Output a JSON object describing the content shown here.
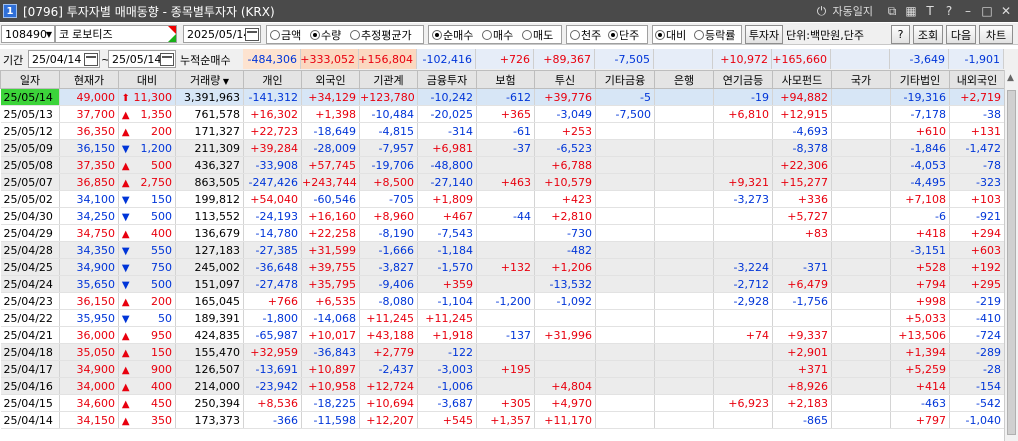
{
  "window": {
    "number": "1",
    "title": "[0796] 투자자별 매매동향 - 종목별투자자 (KRX)",
    "auto_label": "자동일지"
  },
  "toolbar1": {
    "code": "108490",
    "code_prefix": "코",
    "stock_name": "로보티즈",
    "date": "2025/05/14",
    "radio_amount": "금액",
    "radio_qty": "수량",
    "radio_avg": "추정평균가",
    "radio_net": "순매수",
    "radio_buy": "매수",
    "radio_sell": "매도",
    "radio_thousand": "천주",
    "radio_unit": "단주",
    "radio_compare": "대비",
    "radio_rate": "등락률",
    "investor_btn": "투자자",
    "unit_text": "단위:백만원,단주",
    "help": "?",
    "query": "조회",
    "next": "다음",
    "chart": "차트"
  },
  "toolbar2": {
    "period_label": "기간",
    "from": "25/04/14",
    "to": "25/05/14",
    "tilde": "~",
    "cum_label": "누적순매수",
    "sums": [
      "-484,306",
      "+333,052",
      "+156,804",
      "-102,416",
      "+726",
      "+89,367",
      "-7,505",
      "",
      "+10,972",
      "+165,660",
      "",
      "-3,649",
      "-1,901"
    ]
  },
  "columns": [
    "일자",
    "현재가",
    "대비",
    "거래량",
    "개인",
    "외국인",
    "기관계",
    "금융투자",
    "보험",
    "투신",
    "기타금융",
    "은행",
    "연기금등",
    "사모펀드",
    "국가",
    "기타법인",
    "내외국인"
  ],
  "rows": [
    [
      "25/05/14",
      "49,000",
      "up",
      "11,300",
      "3,391,963",
      "-141,312",
      "+34,129",
      "+123,780",
      "-10,242",
      "-612",
      "+39,776",
      "-5",
      "",
      "-19",
      "+94,882",
      "",
      "-19,316",
      "+2,719"
    ],
    [
      "25/05/13",
      "37,700",
      "tri-up",
      "1,350",
      "761,578",
      "+16,302",
      "+1,398",
      "-10,484",
      "-20,025",
      "+365",
      "-3,049",
      "-7,500",
      "",
      "+6,810",
      "+12,915",
      "",
      "-7,178",
      "-38"
    ],
    [
      "25/05/12",
      "36,350",
      "tri-up",
      "200",
      "171,327",
      "+22,723",
      "-18,649",
      "-4,815",
      "-314",
      "-61",
      "+253",
      "",
      "",
      "",
      "-4,693",
      "",
      "+610",
      "+131"
    ],
    [
      "25/05/09",
      "36,150",
      "tri-down",
      "1,200",
      "211,309",
      "+39,284",
      "-28,009",
      "-7,957",
      "+6,981",
      "-37",
      "-6,523",
      "",
      "",
      "",
      "-8,378",
      "",
      "-1,846",
      "-1,472"
    ],
    [
      "25/05/08",
      "37,350",
      "tri-up",
      "500",
      "436,327",
      "-33,908",
      "+57,745",
      "-19,706",
      "-48,800",
      "",
      "+6,788",
      "",
      "",
      "",
      "+22,306",
      "",
      "-4,053",
      "-78"
    ],
    [
      "25/05/07",
      "36,850",
      "tri-up",
      "2,750",
      "863,505",
      "-247,426",
      "+243,744",
      "+8,500",
      "-27,140",
      "+463",
      "+10,579",
      "",
      "",
      "+9,321",
      "+15,277",
      "",
      "-4,495",
      "-323"
    ],
    [
      "25/05/02",
      "34,100",
      "tri-down",
      "150",
      "199,812",
      "+54,040",
      "-60,546",
      "-705",
      "+1,809",
      "",
      "+423",
      "",
      "",
      "-3,273",
      "+336",
      "",
      "+7,108",
      "+103"
    ],
    [
      "25/04/30",
      "34,250",
      "tri-down",
      "500",
      "113,552",
      "-24,193",
      "+16,160",
      "+8,960",
      "+467",
      "-44",
      "+2,810",
      "",
      "",
      "",
      "+5,727",
      "",
      "-6",
      "-921"
    ],
    [
      "25/04/29",
      "34,750",
      "tri-up",
      "400",
      "136,679",
      "-14,780",
      "+22,258",
      "-8,190",
      "-7,543",
      "",
      "-730",
      "",
      "",
      "",
      "+83",
      "",
      "+418",
      "+294"
    ],
    [
      "25/04/28",
      "34,350",
      "tri-down",
      "550",
      "127,183",
      "-27,385",
      "+31,599",
      "-1,666",
      "-1,184",
      "",
      "-482",
      "",
      "",
      "",
      "",
      "",
      "-3,151",
      "+603"
    ],
    [
      "25/04/25",
      "34,900",
      "tri-down",
      "750",
      "245,002",
      "-36,648",
      "+39,755",
      "-3,827",
      "-1,570",
      "+132",
      "+1,206",
      "",
      "",
      "-3,224",
      "-371",
      "",
      "+528",
      "+192"
    ],
    [
      "25/04/24",
      "35,650",
      "tri-down",
      "500",
      "151,097",
      "-27,478",
      "+35,795",
      "-9,406",
      "+359",
      "",
      "-13,532",
      "",
      "",
      "-2,712",
      "+6,479",
      "",
      "+794",
      "+295"
    ],
    [
      "25/04/23",
      "36,150",
      "tri-up",
      "200",
      "165,045",
      "+766",
      "+6,535",
      "-8,080",
      "-1,104",
      "-1,200",
      "-1,092",
      "",
      "",
      "-2,928",
      "-1,756",
      "",
      "+998",
      "-219"
    ],
    [
      "25/04/22",
      "35,950",
      "tri-down",
      "50",
      "189,391",
      "-1,800",
      "-14,068",
      "+11,245",
      "+11,245",
      "",
      "",
      "",
      "",
      "",
      "",
      "",
      "+5,033",
      "-410"
    ],
    [
      "25/04/21",
      "36,000",
      "tri-up",
      "950",
      "424,835",
      "-65,987",
      "+10,017",
      "+43,188",
      "+1,918",
      "-137",
      "+31,996",
      "",
      "",
      "+74",
      "+9,337",
      "",
      "+13,506",
      "-724"
    ],
    [
      "25/04/18",
      "35,050",
      "tri-up",
      "150",
      "155,470",
      "+32,959",
      "-36,843",
      "+2,779",
      "-122",
      "",
      "",
      "",
      "",
      "",
      "+2,901",
      "",
      "+1,394",
      "-289"
    ],
    [
      "25/04/17",
      "34,900",
      "tri-up",
      "900",
      "126,507",
      "-13,691",
      "+10,897",
      "-2,437",
      "-3,003",
      "+195",
      "",
      "",
      "",
      "",
      "+371",
      "",
      "+5,259",
      "-28"
    ],
    [
      "25/04/16",
      "34,000",
      "tri-up",
      "400",
      "214,000",
      "-23,942",
      "+10,958",
      "+12,724",
      "-1,006",
      "",
      "+4,804",
      "",
      "",
      "",
      "+8,926",
      "",
      "+414",
      "-154"
    ],
    [
      "25/04/15",
      "34,600",
      "tri-up",
      "450",
      "250,394",
      "+8,536",
      "-18,225",
      "+10,694",
      "-3,687",
      "+305",
      "+4,970",
      "",
      "",
      "+6,923",
      "+2,183",
      "",
      "-463",
      "-542"
    ],
    [
      "25/04/14",
      "34,150",
      "tri-up",
      "350",
      "173,373",
      "-366",
      "-11,598",
      "+12,207",
      "+545",
      "+1,357",
      "+11,170",
      "",
      "",
      "",
      "-865",
      "",
      "+797",
      "-1,040"
    ]
  ],
  "colors": {
    "up": "#e8000e",
    "down": "#0035d8",
    "highlight": "#3cd43a"
  }
}
